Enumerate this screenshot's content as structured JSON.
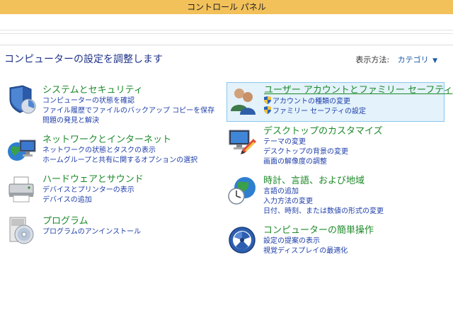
{
  "window": {
    "title": "コントロール パネル"
  },
  "heading": "コンピューターの設定を調整します",
  "view_by": {
    "label": "表示方法:",
    "value": "カテゴリ"
  },
  "categories_left": [
    {
      "title": "システムとセキュリティ",
      "icon": "security-shield-icon",
      "links": [
        "コンピューターの状態を確認",
        "ファイル履歴でファイルのバックアップ コピーを保存",
        "問題の発見と解決"
      ]
    },
    {
      "title": "ネットワークとインターネット",
      "icon": "network-globe-icon",
      "links": [
        "ネットワークの状態とタスクの表示",
        "ホームグループと共有に関するオプションの選択"
      ]
    },
    {
      "title": "ハードウェアとサウンド",
      "icon": "printer-icon",
      "links": [
        "デバイスとプリンターの表示",
        "デバイスの追加"
      ]
    },
    {
      "title": "プログラム",
      "icon": "programs-disc-icon",
      "links": [
        "プログラムのアンインストール"
      ]
    }
  ],
  "categories_right": [
    {
      "title": "ユーザー アカウントとファミリー セーフティ",
      "icon": "users-icon",
      "links": [
        "アカウントの種類の変更",
        "ファミリー セーフティの設定"
      ]
    },
    {
      "title": "デスクトップのカスタマイズ",
      "icon": "monitor-paint-icon",
      "links": [
        "テーマの変更",
        "デスクトップの背景の変更",
        "画面の解像度の調整"
      ]
    },
    {
      "title": "時計、言語、および地域",
      "icon": "clock-globe-icon",
      "links": [
        "言語の追加",
        "入力方法の変更",
        "日付、時刻、または数値の形式の変更"
      ]
    },
    {
      "title": "コンピューターの簡単操作",
      "icon": "ease-of-access-icon",
      "links": [
        "設定の提案の表示",
        "視覚ディスプレイの最適化"
      ]
    }
  ]
}
